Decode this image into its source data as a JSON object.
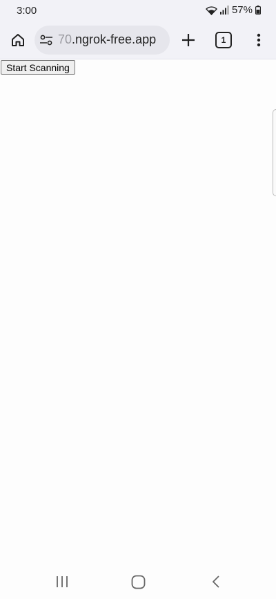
{
  "status_bar": {
    "time": "3:00",
    "battery": "57%",
    "icons": [
      "wifi-icon",
      "signal-icon",
      "battery-icon"
    ]
  },
  "toolbar": {
    "url_faded": "70",
    "url_main": ".ngrok-free.app",
    "tab_count": "1",
    "icons": [
      "home-icon",
      "site-settings-icon",
      "plus-icon",
      "tabs-icon",
      "more-vert-icon"
    ]
  },
  "page": {
    "scan_button_label": "Start Scanning"
  },
  "nav_bar": {
    "icons": [
      "recents-icon",
      "home-circle-icon",
      "back-chevron-icon"
    ]
  },
  "colors": {
    "chrome_bg": "#f2f2f7",
    "url_pill_bg": "#e6e6ec",
    "page_bg": "#fdfdfd",
    "button_bg": "#efefef",
    "button_border": "#767676"
  }
}
